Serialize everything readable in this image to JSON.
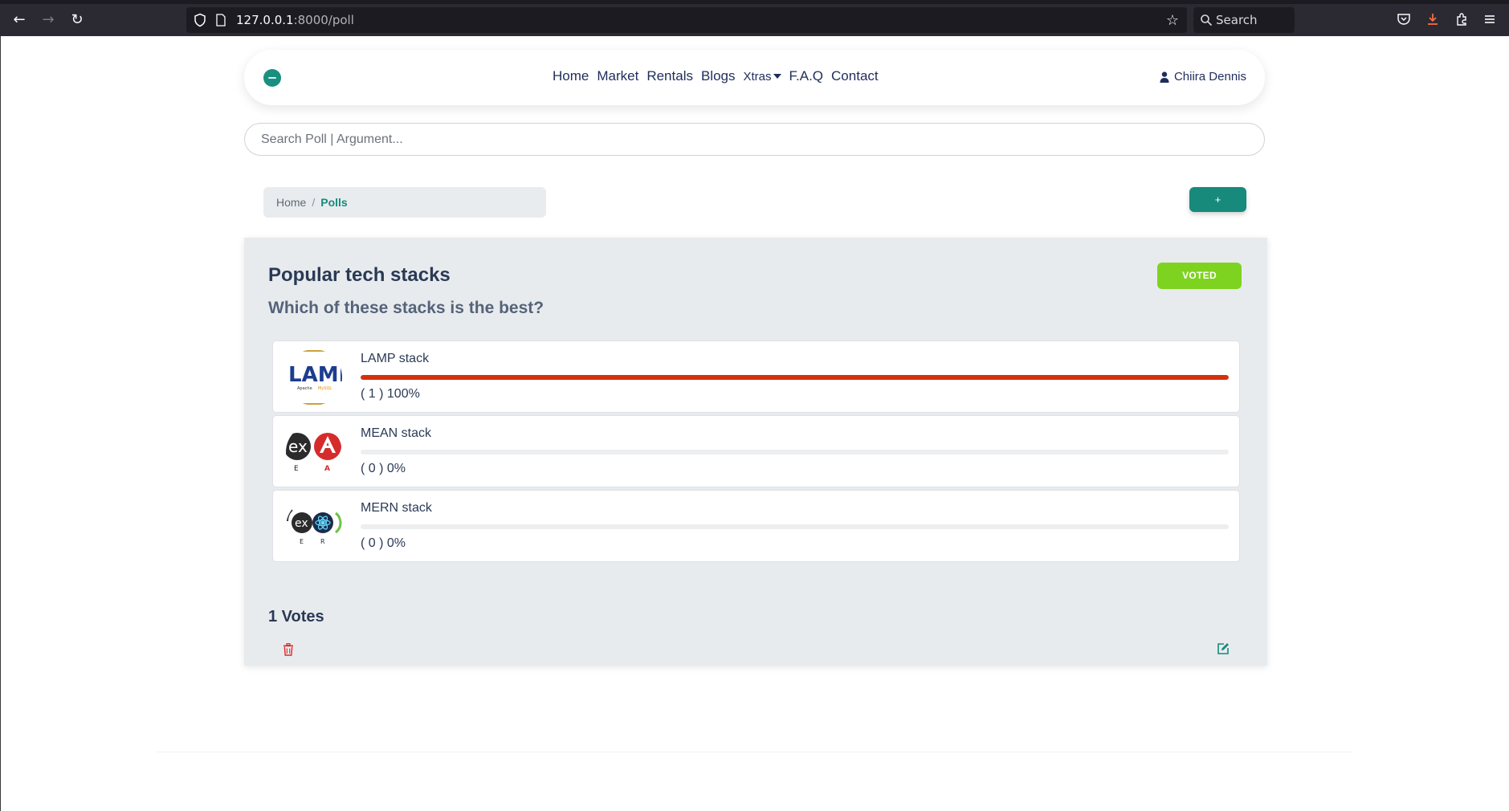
{
  "browser": {
    "url_host": "127.0.0.1",
    "url_path": ":8000/poll",
    "search_label": "Search"
  },
  "navbar": {
    "links": [
      "Home",
      "Market",
      "Rentals",
      "Blogs",
      "Xtras",
      "F.A.Q",
      "Contact"
    ],
    "user_name": "Chiira Dennis"
  },
  "search": {
    "placeholder": "Search Poll | Argument..."
  },
  "breadcrumb": {
    "home": "Home",
    "separator": "/",
    "active": "Polls"
  },
  "add_button_label": "+",
  "poll": {
    "title": "Popular tech stacks",
    "question": "Which of these stacks is the best?",
    "status": "VOTED",
    "options": [
      {
        "label": "LAMP stack",
        "count_text": "( 1 ) 100%",
        "percent": 100
      },
      {
        "label": "MEAN stack",
        "count_text": "( 0 ) 0%",
        "percent": 0
      },
      {
        "label": "MERN stack",
        "count_text": "( 0 ) 0%",
        "percent": 0
      }
    ],
    "total_votes": "1 Votes"
  },
  "colors": {
    "accent": "#178a7c",
    "voted": "#7ed321",
    "bar_fill": "#d4310f",
    "delete": "#e0282a"
  }
}
